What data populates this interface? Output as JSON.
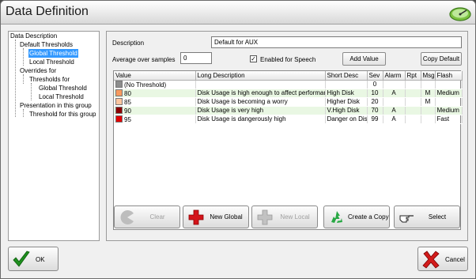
{
  "window": {
    "title": "Data Definition"
  },
  "tree": {
    "items": [
      {
        "label": "Data Description",
        "level": 0
      },
      {
        "label": "Default Thresholds",
        "level": 1
      },
      {
        "label": "Global Threshold",
        "level": 2,
        "selected": true
      },
      {
        "label": "Local Threshold",
        "level": 2
      },
      {
        "label": "Overrides for",
        "level": 1
      },
      {
        "label": "Thresholds for",
        "level": 2
      },
      {
        "label": "Global Threshold",
        "level": 3
      },
      {
        "label": "Local Threshold",
        "level": 3
      },
      {
        "label": "Presentation in this group",
        "level": 1
      },
      {
        "label": "Threshold for this group",
        "level": 2
      }
    ]
  },
  "form": {
    "description_label": "Description",
    "description_value": "Default for AUX",
    "average_label": "Average over samples",
    "average_value": "0",
    "speech_label": "Enabled for Speech",
    "speech_checked": true,
    "add_value_label": "Add Value",
    "copy_default_label": "Copy Default"
  },
  "table": {
    "columns": [
      "Value",
      "Long Description",
      "Short Desc",
      "Sev",
      "Alarm",
      "Rpt",
      "Msg",
      "Flash"
    ],
    "rows": [
      {
        "color": "#8c8c8c",
        "value": "(No Threshold)",
        "long": "",
        "short": "",
        "sev": "0",
        "alarm": "",
        "rpt": "",
        "msg": "",
        "flash": ""
      },
      {
        "color": "#f79a5e",
        "value": "80",
        "long": "Disk Usage is high enough to affect performance",
        "short": "High Disk",
        "sev": "10",
        "alarm": "A",
        "rpt": "",
        "msg": "M",
        "flash": "Medium"
      },
      {
        "color": "#fcc6a0",
        "value": "85",
        "long": "Disk Usage is becoming a worry",
        "short": "Higher Disk",
        "sev": "20",
        "alarm": "",
        "rpt": "",
        "msg": "M",
        "flash": ""
      },
      {
        "color": "#8b0000",
        "value": "90",
        "long": "Disk Usage is very high",
        "short": "V.High Disk",
        "sev": "70",
        "alarm": "A",
        "rpt": "",
        "msg": "",
        "flash": "Medium"
      },
      {
        "color": "#e00000",
        "value": "95",
        "long": "Disk Usage is dangerously high",
        "short": "Danger on Disk",
        "sev": "99",
        "alarm": "A",
        "rpt": "",
        "msg": "",
        "flash": "Fast"
      }
    ]
  },
  "actions": {
    "clear": "Clear",
    "new_global": "New Global",
    "new_local": "New Local",
    "create_copy": "Create a Copy",
    "select": "Select"
  },
  "footer": {
    "ok": "OK",
    "cancel": "Cancel"
  },
  "colors": {
    "selection": "#3399ff",
    "alt_row": "#e9f7e3",
    "title_text": "#1a1a1a"
  },
  "icons": {
    "app": "speedometer-icon",
    "clear": "pacman-icon",
    "new_global": "red-plus-icon",
    "new_local": "gray-plus-icon",
    "create_copy": "recycle-icon",
    "select": "pointing-hand-icon",
    "ok": "green-check-icon",
    "cancel": "red-x-icon"
  }
}
